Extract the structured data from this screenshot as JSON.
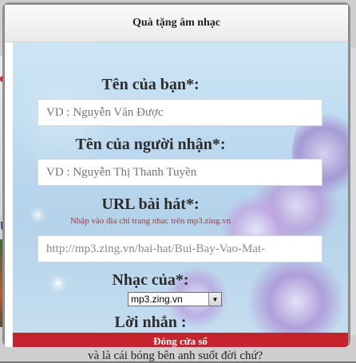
{
  "modal": {
    "title": "Quà tặng âm nhạc",
    "close_label": "Đóng cửa sổ"
  },
  "form": {
    "your_name_label": "Tên của bạn*:",
    "your_name_placeholder": "VD : Nguyễn Văn Được",
    "recipient_label": "Tên của người nhận*:",
    "recipient_placeholder": "VD : Nguyễn Thị Thanh Tuyền",
    "url_label": "URL bài hát*:",
    "url_hint": "Nhập vào địa chỉ trang nhạc trên mp3.zing.vn",
    "url_value": "http://mp3.zing.vn/bai-hat/Bui-Bay-Vao-Mat-",
    "source_label": "Nhạc của*:",
    "source_selected": "mp3.zing.vn",
    "message_label": "Lời nhắn :"
  },
  "background_page": {
    "bottom_text": "và là cái bóng bên anh suốt đời chứ?"
  },
  "icons": {
    "dropdown": "chevron-down-icon"
  },
  "colors": {
    "close_bar": "#c8232c",
    "hint": "#c0302a"
  }
}
